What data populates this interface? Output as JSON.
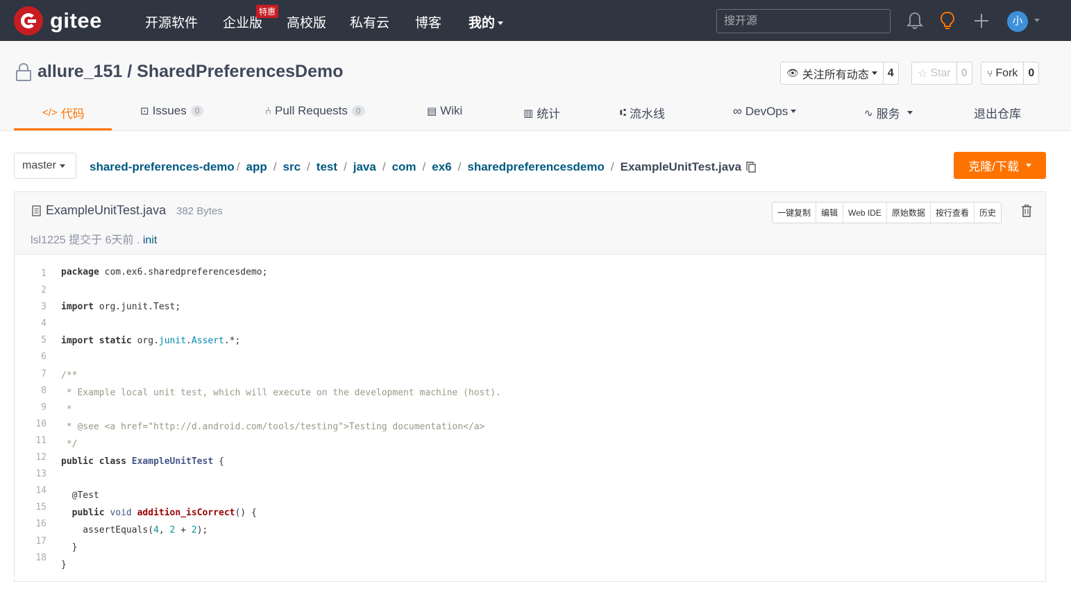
{
  "nav": {
    "logo_text": "gitee",
    "items": [
      "开源软件",
      "企业版",
      "高校版",
      "私有云",
      "博客",
      "我的"
    ],
    "enterprise_badge": "特惠",
    "search_placeholder": "搜开源",
    "avatar_text": "小",
    "accent": "#c71d23"
  },
  "repo": {
    "title": "allure_151 / SharedPreferencesDemo",
    "watch_label": "关注所有动态",
    "watch_count": "4",
    "star_label": "Star",
    "star_count": "0",
    "fork_label": "Fork",
    "fork_count": "0"
  },
  "tabs": [
    {
      "label": "代码",
      "icon": "code-icon"
    },
    {
      "label": "Issues",
      "count": "0",
      "icon": "issues-icon"
    },
    {
      "label": "Pull Requests",
      "count": "0",
      "icon": "pull-request-icon"
    },
    {
      "label": "Wiki",
      "icon": "wiki-icon"
    },
    {
      "label": "统计",
      "icon": "stats-icon"
    },
    {
      "label": "流水线",
      "icon": "pipeline-icon"
    },
    {
      "label": "DevOps",
      "icon": "devops-icon"
    },
    {
      "label": "服务",
      "icon": "service-icon"
    },
    {
      "label": "退出仓库"
    }
  ],
  "branch": "master",
  "breadcrumb": [
    "shared-preferences-demo",
    "app",
    "src",
    "test",
    "java",
    "com",
    "ex6",
    "sharedpreferencesdemo"
  ],
  "breadcrumb_file": "ExampleUnitTest.java",
  "clone_label": "克隆/下载",
  "accent_orange": "#fe7300",
  "file": {
    "name": "ExampleUnitTest.java",
    "size": "382 Bytes",
    "commit_author": "lsl1225 提交于 6天前 .",
    "commit_msg": "init",
    "actions": [
      "一键复制",
      "编辑",
      "Web IDE",
      "原始数据",
      "按行查看",
      "历史"
    ]
  },
  "code_lines": [
    "package com.ex6.sharedpreferencesdemo;",
    "",
    "import org.junit.Test;",
    "",
    "import static org.junit.Assert.*;",
    "",
    "/**",
    " * Example local unit test, which will execute on the development machine (host).",
    " *",
    " * @see <a href=\"http://d.android.com/tools/testing\">Testing documentation</a>",
    " */",
    "public class ExampleUnitTest {",
    "",
    "  @Test",
    "  public void addition_isCorrect() {",
    "    assertEquals(4, 2 + 2);",
    "  }",
    "}"
  ],
  "line_numbers": [
    "1",
    "2",
    "3",
    "4",
    "5",
    "6",
    "7",
    "8",
    "9",
    "10",
    "11",
    "12",
    "13",
    "14",
    "15",
    "16",
    "17",
    "18"
  ]
}
